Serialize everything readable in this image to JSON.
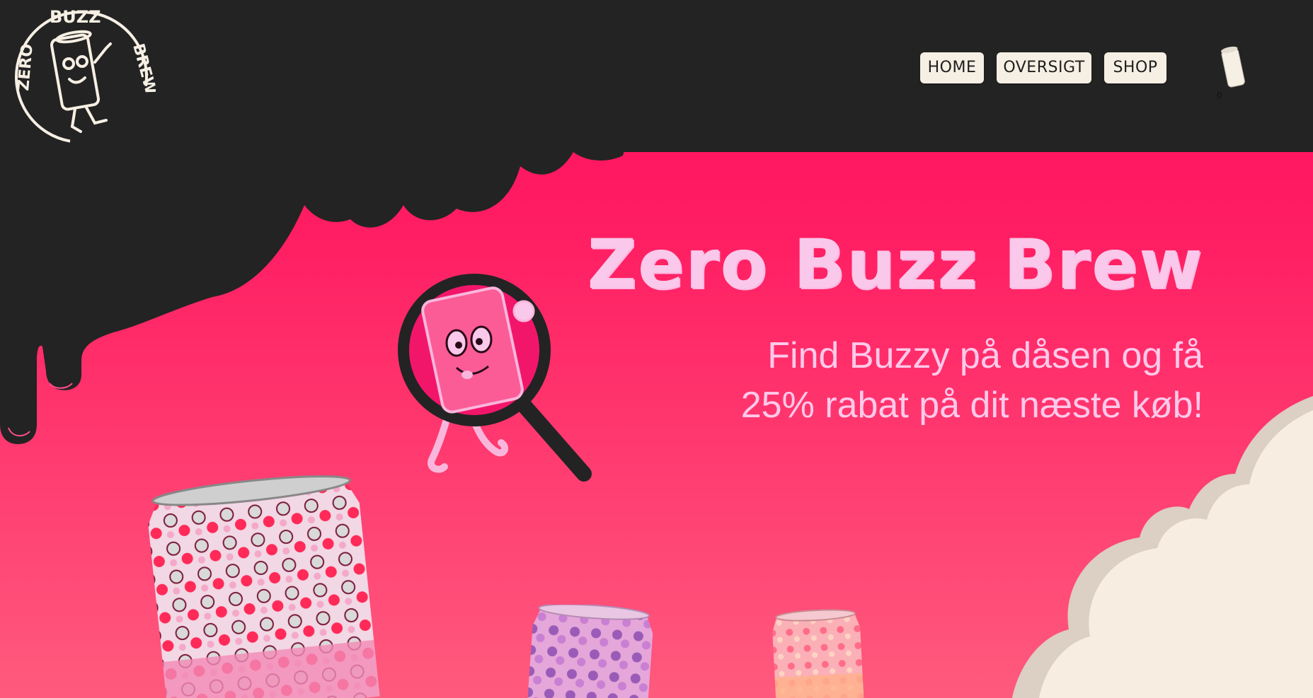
{
  "logo": {
    "top_text": "BUZZ",
    "left_text": "ZERO",
    "right_text": "BREW"
  },
  "nav": {
    "home_label": "HOME",
    "oversigt_label": "OVERSIGT",
    "shop_label": "SHOP"
  },
  "cart": {
    "count": "0",
    "icon": "can-cart-icon"
  },
  "hero": {
    "title": "Zero Buzz Brew",
    "subtitle_line1": "Find Buzzy på dåsen og få",
    "subtitle_line2": "25% rabat på dit næste køb!"
  },
  "colors": {
    "header_bg": "#232323",
    "hero_pink": "#ff1f63",
    "title_pink": "#f9c8ea",
    "nav_bg": "#f6efe3",
    "cloud_cream": "#f8ede1"
  }
}
